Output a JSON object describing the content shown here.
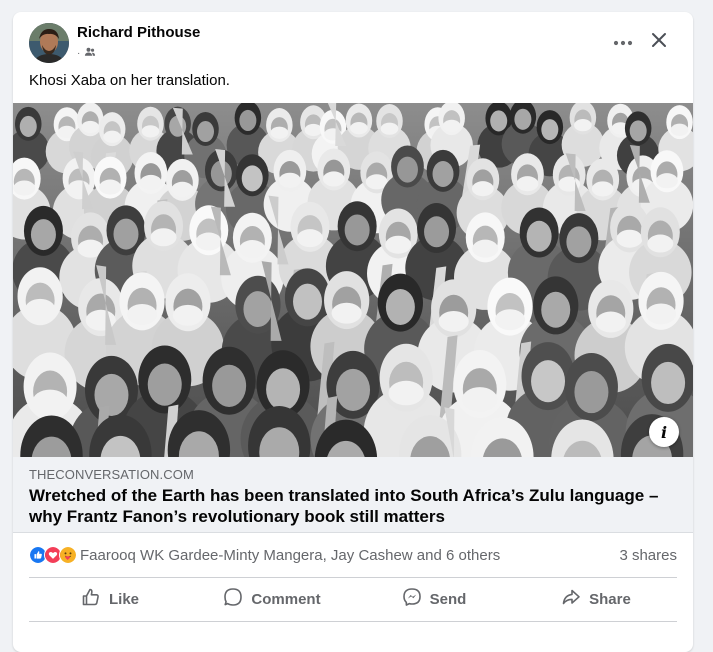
{
  "post": {
    "author": "Richard Pithouse",
    "text": "Khosi Xaba on her translation."
  },
  "link": {
    "domain": "THECONVERSATION.COM",
    "title": "Wretched of the Earth has been translated into South Africa’s Zulu language – why Frantz Fanon’s revolutionary book still matters",
    "info_label": "i"
  },
  "engagement": {
    "reactors": "Faarooq WK Gardee-Minty Mangera, Jay Cashew and 6 others",
    "shares": "3 shares",
    "reaction_types": [
      "like",
      "love",
      "care"
    ]
  },
  "actions": {
    "like": "Like",
    "comment": "Comment",
    "send": "Send",
    "share": "Share"
  },
  "colors": {
    "like_blue": "#1877f2",
    "love_red": "#f33e58",
    "care_yellow": "#f7b125",
    "secondary_text": "#65676b"
  },
  "icons": {
    "audience": "friends-icon",
    "more": "more-icon",
    "close": "close-icon"
  }
}
